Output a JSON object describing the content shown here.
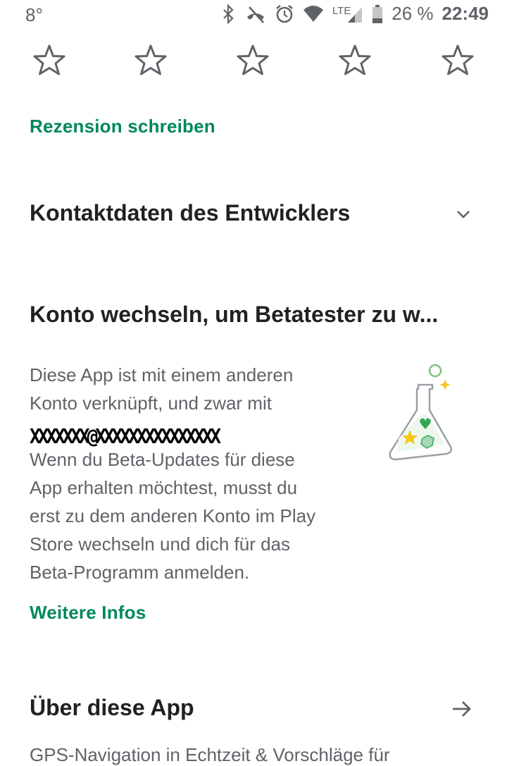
{
  "status_bar": {
    "temperature": "8°",
    "network_type": "LTE",
    "battery": "26 %",
    "time": "22:49",
    "icons": [
      "bluetooth-icon",
      "no-calls-icon",
      "alarm-icon",
      "wifi-icon",
      "signal-icon",
      "battery-icon"
    ]
  },
  "rating": {
    "stars": [
      {
        "name": "star-1-icon"
      },
      {
        "name": "star-2-icon"
      },
      {
        "name": "star-3-icon"
      },
      {
        "name": "star-4-icon"
      },
      {
        "name": "star-5-icon"
      }
    ],
    "value": 0,
    "max": 5
  },
  "review": {
    "write_label": "Rezension schreiben"
  },
  "developer": {
    "title": "Kontaktdaten des Entwicklers"
  },
  "beta": {
    "title": "Konto wechseln, um Betatester zu w...",
    "line1": "Diese App ist mit einem anderen",
    "line2": "Konto verknüpft, und zwar mit",
    "redacted_email": "XXXXXXX@XXXXXXXXXXXXXXX",
    "line3": "Wenn du Beta-Updates für diese",
    "line4": "App erhalten möchtest, musst du",
    "line5": "erst zu dem anderen Konto im Play",
    "line6": "Store wechseln und dich für das",
    "line7": "Beta-Programm anmelden.",
    "more_label": "Weitere Infos"
  },
  "about": {
    "title": "Über diese App",
    "description": "GPS-Navigation in Echtzeit & Vorschläge für"
  },
  "colors": {
    "accent": "#01875f",
    "text_primary": "#202124",
    "text_secondary": "#5f6368"
  }
}
